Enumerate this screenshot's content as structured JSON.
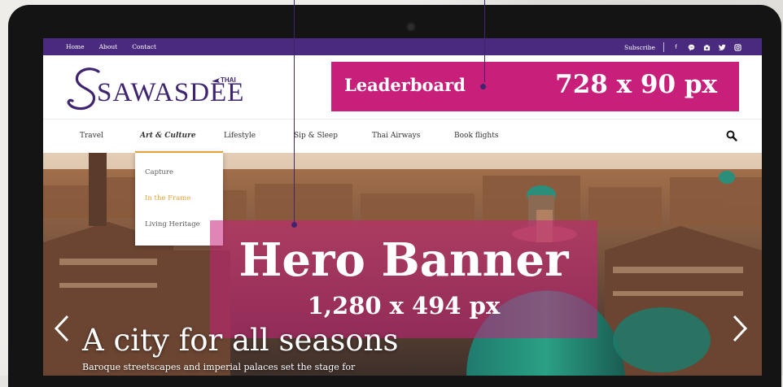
{
  "topbar": {
    "nav": [
      "Home",
      "About",
      "Contact"
    ],
    "subscribe": "Subscribe",
    "social_icons": [
      "facebook-icon",
      "chat-icon",
      "instagram-camera-icon",
      "twitter-icon",
      "instagram-icon"
    ]
  },
  "logo": {
    "word": "SAWASDEE",
    "thai": "THAI"
  },
  "leaderboard": {
    "label": "Leaderboard",
    "size": "728 x 90 px"
  },
  "main_nav": [
    "Travel",
    "Art & Culture",
    "Lifestyle",
    "Sip & Sleep",
    "Thai Airways",
    "Book flights"
  ],
  "dropdown": [
    "Capture",
    "In the Frame",
    "Living Heritage"
  ],
  "hero": {
    "title": "Hero Banner",
    "size": "1,280 x 494 px",
    "headline": "A city for all seasons",
    "subtext": "Baroque streetscapes and imperial palaces set the stage for"
  },
  "colors": {
    "purple": "#4a2a7e",
    "magenta": "#c8207a",
    "orange": "#e5a13b"
  }
}
